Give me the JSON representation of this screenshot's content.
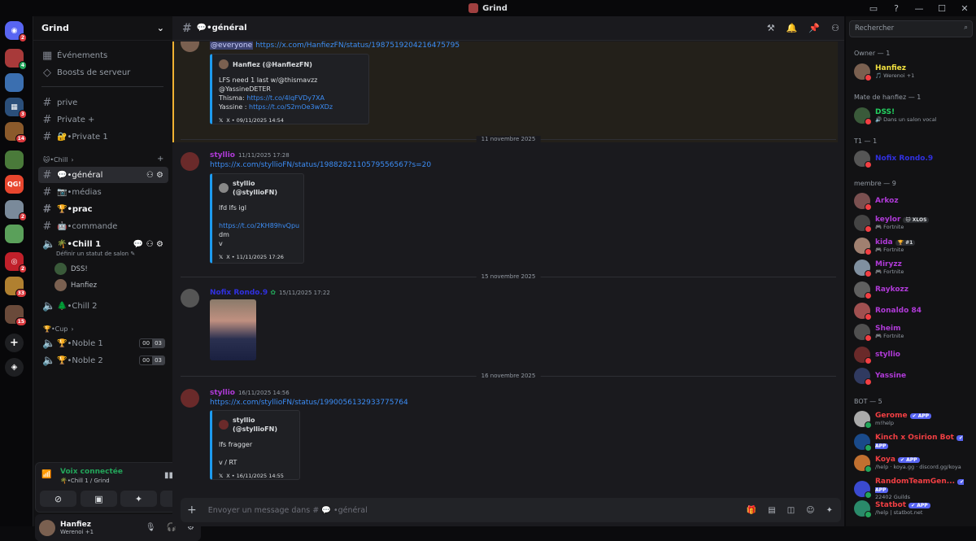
{
  "window": {
    "title": "Grind"
  },
  "servers": [
    {
      "label": "",
      "color": "#5865f2",
      "badge": "2"
    },
    {
      "label": "",
      "color": "#a83a3a",
      "badge": "4"
    },
    {
      "label": "",
      "color": "#3b6fb0",
      "badge": ""
    },
    {
      "label": "",
      "color": "#2b4f7a",
      "badge": "3"
    },
    {
      "label": "",
      "color": "#8b5a2b",
      "badge": "14"
    },
    {
      "label": "",
      "color": "#4a7a3a",
      "badge": ""
    },
    {
      "label": "QG!",
      "color": "#e8462e",
      "badge": ""
    },
    {
      "label": "",
      "color": "#7a8a9a",
      "badge": "2"
    },
    {
      "label": "",
      "color": "#5aa05a",
      "badge": ""
    },
    {
      "label": "",
      "color": "#c0202a",
      "badge": "2"
    },
    {
      "label": "",
      "color": "#b08030",
      "badge": "33"
    },
    {
      "label": "",
      "color": "#6a4a3a",
      "badge": "15"
    }
  ],
  "guild": {
    "name": "Grind"
  },
  "sidebar": {
    "events": "Événements",
    "boosts": "Boosts de serveur",
    "channels": [
      {
        "name": "prive",
        "type": "text"
      },
      {
        "name": "Private +",
        "type": "text"
      },
      {
        "name": "🔐•Private 1",
        "type": "text"
      },
      {
        "name": "💬•général",
        "type": "text"
      },
      {
        "name": "📷•médias",
        "type": "text"
      },
      {
        "name": "🏆•prac",
        "type": "text"
      },
      {
        "name": "🤖•commande",
        "type": "text"
      },
      {
        "name": "🌴•Chill 1",
        "type": "voice"
      },
      {
        "name": "🌲•Chill 2",
        "type": "voice"
      },
      {
        "name": "🏆•Noble 1",
        "type": "voice"
      },
      {
        "name": "🏆•Noble 2",
        "type": "voice"
      }
    ],
    "cat_chill": "🐱•Chill",
    "cat_cup": "🏆•Cup",
    "voice_status": "Définir un statut de salon",
    "voice_users": [
      "DSS!",
      "Hanfiez"
    ],
    "noble1": [
      "00",
      "03"
    ],
    "noble2": [
      "00",
      "03"
    ]
  },
  "voice": {
    "status": "Voix connectée",
    "channel": "🌴•Chill 1 / Grind"
  },
  "user": {
    "name": "Hanfiez",
    "status": "Werenoi +1"
  },
  "chat": {
    "channel": "💬•général",
    "messages": [
      {
        "mention": "@everyone",
        "link": "https://x.com/HanfiezFN/status/1987519204216475795",
        "embed": {
          "author": "Hanfiez (@HanfiezFN)",
          "lines": [
            "LFS need 1 last w/@thismavzz @YassineDETER"
          ],
          "l2pre": "Thisma: ",
          "l2link": "https://t.co/4lqFVDy7XA",
          "l3pre": "Yassine : ",
          "l3link": "https://t.co/S2mOe3wXDz",
          "footer": "X • 09/11/2025 14:54"
        }
      },
      {
        "user": "styllio",
        "time": "11/11/2025 17:28",
        "link": "https://x.com/styllioFN/status/1988282110579556567?s=20",
        "embed": {
          "author": "styllio (@styllioFN)",
          "l1": "lfd lfs igl",
          "l2link": "https://t.co/2KH89hvQpu",
          "l3": "dm",
          "l4": "v",
          "footer": "X • 11/11/2025 17:26"
        }
      },
      {
        "user": "Nofix Rondo.9",
        "time": "15/11/2025 17:22"
      },
      {
        "user": "styllio",
        "time": "16/11/2025 14:56",
        "link": "https://x.com/styllioFN/status/1990056132933775764",
        "embed": {
          "author": "styllio (@styllioFN)",
          "l1": "lfs fragger",
          "l2": "v / RT",
          "footer": "X • 16/11/2025 14:55"
        }
      }
    ],
    "dates": [
      "11 novembre 2025",
      "15 novembre 2025",
      "16 novembre 2025"
    ],
    "placeholder": "Envoyer un message dans # 💬 •général"
  },
  "members": {
    "search": "Rechercher",
    "sections": [
      "Owner — 1",
      "Mate de hanfiez — 1",
      "T1 — 1",
      "membre — 9",
      "BOT — 5"
    ],
    "list": [
      {
        "name": "Hanfiez",
        "sub": "🎵 Werenoi +1",
        "color": "#f0e040"
      },
      {
        "name": "DSS!",
        "sub": "🔊 Dans un salon vocal",
        "color": "#23d160"
      },
      {
        "name": "Nofix Rondo.9",
        "sub": "",
        "color": "#3030e0"
      },
      {
        "name": "Arkoz",
        "sub": "",
        "color": "#b03ad8"
      },
      {
        "name": "keylor",
        "sub": "🎮 Fortnite",
        "color": "#b03ad8",
        "tag": "🐱 XLOS"
      },
      {
        "name": "kida",
        "sub": "🎮 Fortnite",
        "color": "#b03ad8",
        "tag": "🏆 #1"
      },
      {
        "name": "Miryzz",
        "sub": "🎮 Fortnite",
        "color": "#b03ad8"
      },
      {
        "name": "Raykozz",
        "sub": "",
        "color": "#b03ad8"
      },
      {
        "name": "Ronaldo 84",
        "sub": "",
        "color": "#b03ad8"
      },
      {
        "name": "Sheim",
        "sub": "🎮 Fortnite",
        "color": "#b03ad8"
      },
      {
        "name": "styllio",
        "sub": "",
        "color": "#b03ad8"
      },
      {
        "name": "Yassine",
        "sub": "",
        "color": "#b03ad8"
      },
      {
        "name": "Gerome",
        "sub": "m!help",
        "color": "#f23f43",
        "app": "✔ APP"
      },
      {
        "name": "Kinch x Osirion Bot",
        "sub": "",
        "color": "#f23f43",
        "app": "✔ APP"
      },
      {
        "name": "Koya",
        "sub": "/help · koya.gg · discord.gg/koya",
        "color": "#f23f43",
        "app": "✔ APP"
      },
      {
        "name": "RandomTeamGen...",
        "sub": "22402 Guilds",
        "color": "#f23f43",
        "app": "✔ APP"
      },
      {
        "name": "Statbot",
        "sub": "/help | statbot.net",
        "color": "#f23f43",
        "app": "✔ APP"
      }
    ]
  }
}
